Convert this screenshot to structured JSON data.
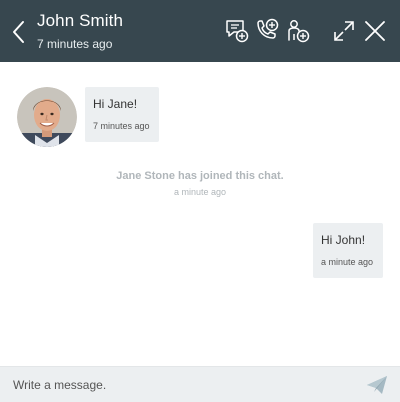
{
  "header": {
    "title": "John Smith",
    "subtitle": "7 minutes ago",
    "icons": [
      "back-icon",
      "add-chat-icon",
      "add-call-icon",
      "add-participant-icon",
      "expand-icon",
      "close-icon"
    ]
  },
  "messages": [
    {
      "direction": "incoming",
      "text": "Hi Jane!",
      "time": "7 minutes ago",
      "avatar": "john-smith-avatar"
    },
    {
      "direction": "system",
      "text": "Jane Stone has joined this chat.",
      "time": "a minute ago"
    },
    {
      "direction": "outgoing",
      "text": "Hi John!",
      "time": "a minute ago"
    }
  ],
  "composer": {
    "placeholder": "Write a message.",
    "value": "",
    "send_icon": "send-icon"
  },
  "colors": {
    "header_bg": "#37474f",
    "bubble_bg": "#eceff1",
    "system_text": "#b0b6ba",
    "send_icon": "#a5b9c3"
  }
}
